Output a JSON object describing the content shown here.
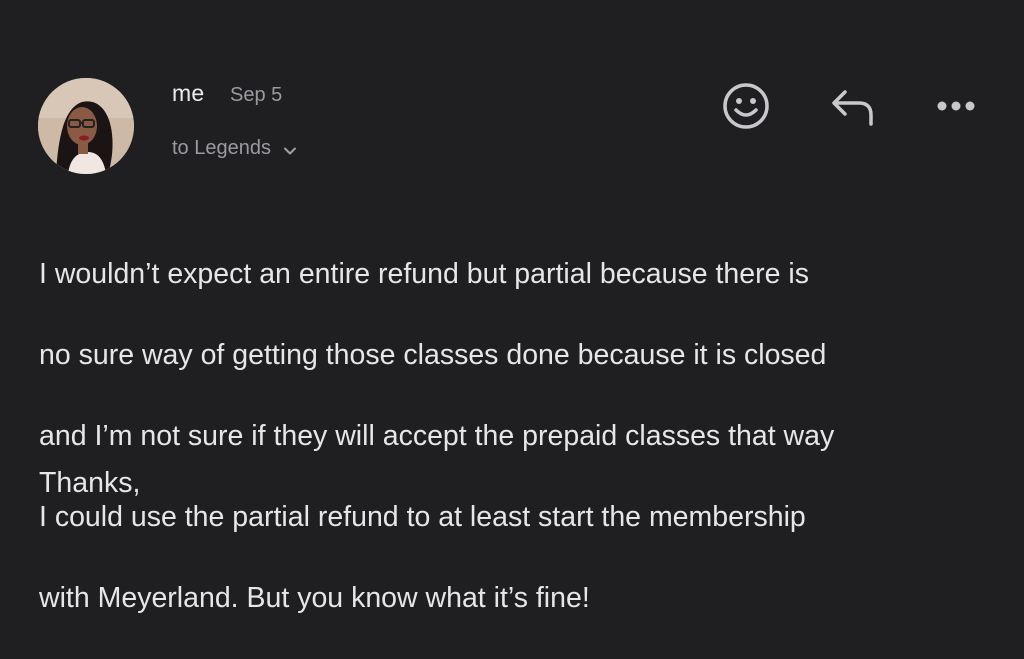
{
  "message": {
    "sender": "me",
    "date": "Sep 5",
    "recipient": "to Legends",
    "body_lines": [
      "I wouldn’t expect an entire refund but partial because there is",
      "no sure way of getting those classes done because it is closed",
      "and I’m not sure if they will accept the prepaid classes that way",
      "I could use the partial refund to at least start the membership",
      "with Meyerland. But you know what it’s fine!"
    ],
    "signoff": "Thanks,"
  },
  "icons": {
    "avatar": "avatar",
    "emoji": "emoji-reaction-icon",
    "reply": "reply-icon",
    "more": "more-options-icon",
    "expand": "chevron-down-icon"
  },
  "colors": {
    "background": "#1f1f21",
    "text": "#e6e6e6",
    "muted": "#9a9aa0",
    "icon": "#c8c8cc"
  }
}
